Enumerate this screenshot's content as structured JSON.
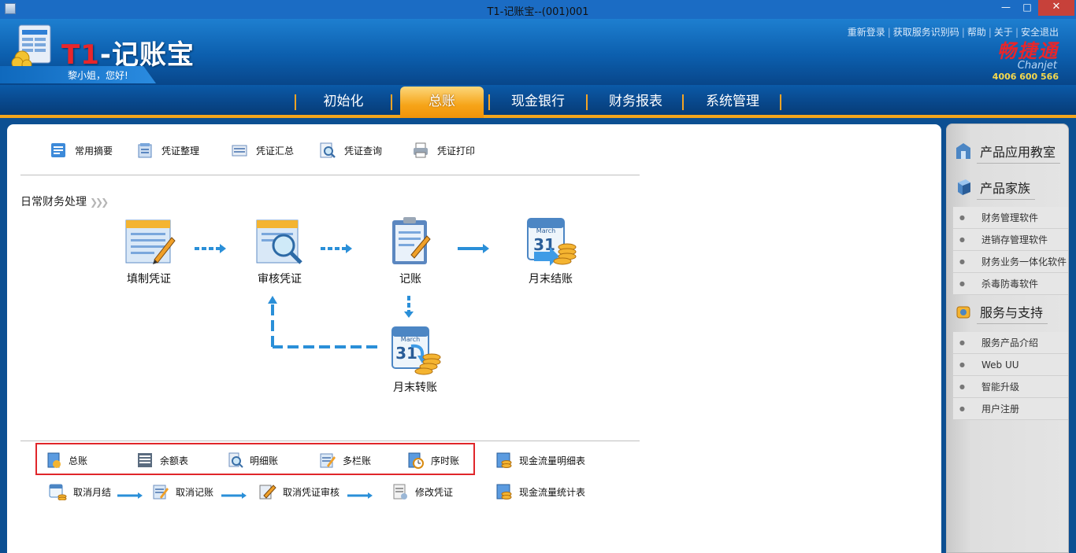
{
  "window": {
    "title": "T1-记账宝--(001)001",
    "minimize": "—",
    "maximize": "□",
    "close": "✕"
  },
  "header": {
    "logo_prefix": "T1",
    "logo_suffix": "-记账宝",
    "greeting": "黎小姐，您好!",
    "links": [
      "重新登录",
      "获取服务识别码",
      "帮助",
      "关于",
      "安全退出"
    ],
    "link_seps": [
      "|",
      "|",
      "|",
      "|"
    ],
    "brand_cn": "畅捷通",
    "brand_en": "Chanjet",
    "brand_phone": "4006 600 566"
  },
  "nav": {
    "items": [
      "初始化",
      "总账",
      "现金银行",
      "财务报表",
      "系统管理"
    ],
    "active": "总账"
  },
  "toolbar": {
    "items": [
      "常用摘要",
      "凭证整理",
      "凭证汇总",
      "凭证查询",
      "凭证打印"
    ]
  },
  "section": {
    "title": "日常财务处理"
  },
  "flow": {
    "fill_voucher": "填制凭证",
    "audit_voucher": "审核凭证",
    "post": "记账",
    "month_end_close": "月末结账",
    "month_end_transfer": "月末转账",
    "calendar_month": "March",
    "calendar_day_close": "31",
    "calendar_day_transfer": "31"
  },
  "reports_row1": [
    "总账",
    "余额表",
    "明细账",
    "多栏账",
    "序时账",
    "现金流量明细表"
  ],
  "reports_row2": [
    "取消月结",
    "取消记账",
    "取消凭证审核",
    "修改凭证",
    "现金流量统计表"
  ],
  "sidebar": {
    "classroom": "产品应用教室",
    "family": "产品家族",
    "family_items": [
      "财务管理软件",
      "进销存管理软件",
      "财务业务一体化软件",
      "杀毒防毒软件"
    ],
    "support": "服务与支持",
    "support_items": [
      "服务产品介绍",
      "Web UU",
      "智能升级",
      "用户注册"
    ]
  },
  "colors": {
    "highlight_box": "#e0262a",
    "nav_active": "#f6a418",
    "header_blue": "#0c5fae"
  }
}
